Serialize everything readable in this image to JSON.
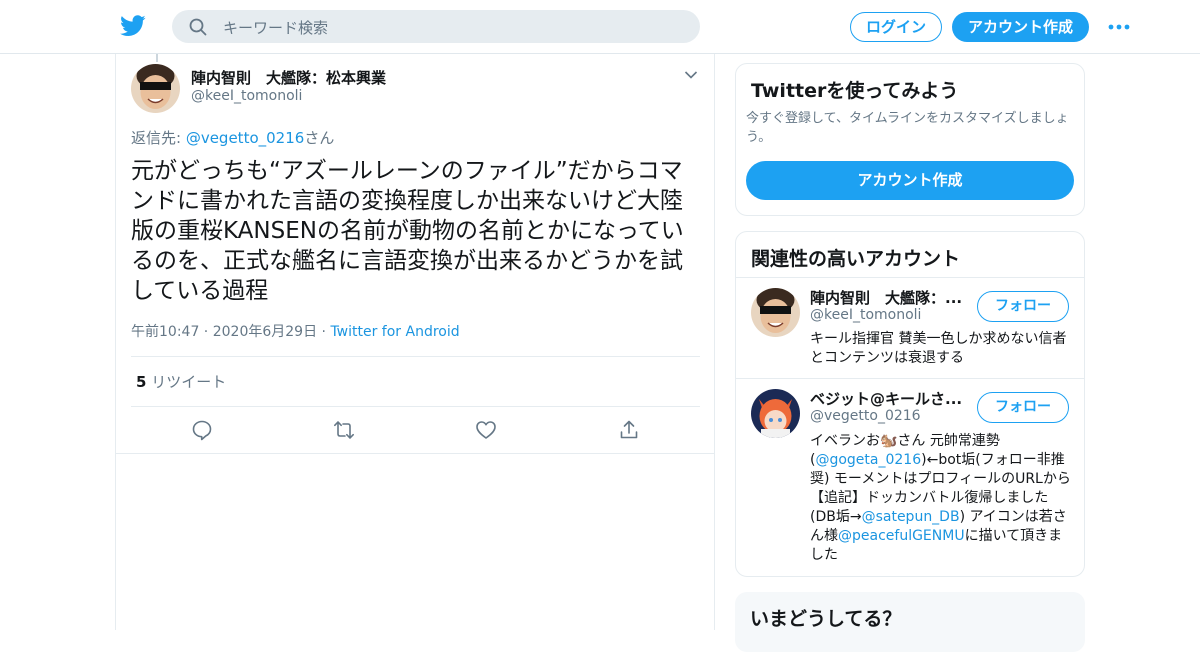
{
  "header": {
    "search_placeholder": "キーワード検索",
    "login_label": "ログイン",
    "signup_label": "アカウント作成",
    "brand_color": "#1da1f2"
  },
  "tweet": {
    "author_name": "陣内智則　大艦隊：松本興業",
    "author_handle": "@keeI_tomonoli",
    "reply_prefix": "返信先: ",
    "reply_handle": "@vegetto_0216",
    "reply_suffix": "さん",
    "text": "元がどっちも“アズールレーンのファイル”だからコマンドに書かれた言語の変換程度しか出来ないけど大陸版の重桜KANSENの名前が動物の名前とかになっているのを、正式な艦名に言語変換が出来るかどうかを試している過程",
    "time": "午前10:47",
    "date": "2020年6月29日",
    "source": "Twitter for Android",
    "retweet_count": "5",
    "retweet_label": "リツイート",
    "icons": [
      "reply-icon",
      "retweet-icon",
      "like-icon",
      "share-icon"
    ]
  },
  "sidebar": {
    "cta": {
      "title": "Twitterを使ってみよう",
      "text": "今すぐ登録して、タイムラインをカスタマイズしましょう。",
      "button": "アカウント作成"
    },
    "related": {
      "title": "関連性の高いアカウント",
      "accounts": [
        {
          "name": "陣内智則　大艦隊：...",
          "handle": "@keeI_tomonoli",
          "follow": "フォロー",
          "bio": "キール指揮官 賛美一色しか求めない信者とコンテンツは衰退する"
        },
        {
          "name": "ベジット@キールさ...",
          "handle": "@vegetto_0216",
          "follow": "フォロー",
          "bio_1": "イベランお🐿️さん 元帥常連勢(",
          "bio_link_1": "@gogeta_0216",
          "bio_2": ")←bot垢(フォロー非推奨) モーメントはプロフィールのURLから 【追記】ドッカンバトル復帰しました(DB垢→",
          "bio_link_2": "@satepun_DB",
          "bio_3": ") アイコンは若さん様",
          "bio_link_3": "@peacefulGENMU",
          "bio_4": "に描いて頂きました"
        }
      ]
    },
    "trends": {
      "title": "いまどうしてる？"
    }
  }
}
